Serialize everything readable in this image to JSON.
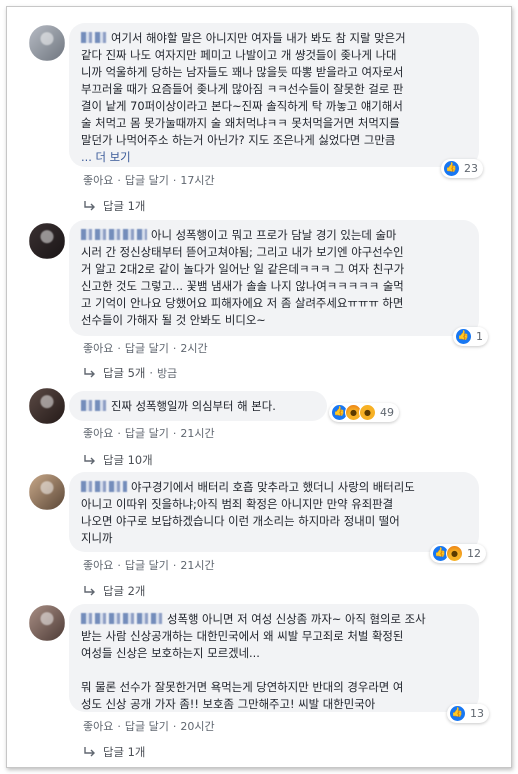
{
  "comments": [
    {
      "text_lines": [
        "여기서 해야할 말은 아니지만 여자들 내가 봐도 참 지랄 맞은거",
        "같다 진짜 나도 여자지만 페미고 나발이고 개 썅것들이 좆나게 나대",
        "니까 억울하게 당하는 남자들도 꽤나 많을듯 따뽕 받을라고 여자로서",
        "부끄러울 때가 요즘들어 좆나게 많아짐 ㅋㅋ선수들이 잘못한 걸로 판",
        "결이 낱게 70퍼이상이라고 본다~진짜 솔직하게 탁 까놓고 얘기해서",
        "술 처먹고 몸 못가눌때까지 술 왜처먹냐ㅋㅋ 못처먹을거면 처먹지를",
        "말던가 나먹어주소 하는거 아닌가? 지도 조은나게 싫었다면 그만큼"
      ],
      "see_more": "... 더 보기",
      "like_label": "좋아요",
      "reply_label": "답글 달기",
      "time": "17시간",
      "reaction_count": "23",
      "replies": "답글 1개"
    },
    {
      "text_lines": [
        "아니 성폭행이고 뭐고 프로가 담날 경기 있는데 술마",
        "시러 간 정신상태부터 뜯어고쳐야됨; 그리고 내가 보기엔 야구선수인",
        "거 알고 2대2로 같이 놀다가 일어난 일 같은데ㅋㅋㅋ 그 여자 친구가",
        "신고한 것도 그렇고... 꽃뱀 냄새가 솔솔 나지 않나여ㅋㅋㅋㅋㅋ 술먹",
        "고 기억이 안나요 당했어요 피해자에요 저 좀 살려주세요ㅠㅠㅠ 하면",
        "선수들이 가해자 될 것 안봐도 비디오~"
      ],
      "like_label": "좋아요",
      "reply_label": "답글 달기",
      "time": "2시간",
      "reaction_count": "1",
      "replies": "답글 5개",
      "replies_extra": "방금"
    },
    {
      "text_lines": [
        "진짜 성폭행일까 의심부터 해 본다."
      ],
      "like_label": "좋아요",
      "reply_label": "답글 달기",
      "time": "21시간",
      "reaction_count": "49",
      "replies": "답글 10개"
    },
    {
      "text_lines": [
        "야구경기에서 배터리 호흡 맞추라고 했더니 사랑의 배터리도",
        "아니고 이따위 짓을하냐;아직 범죄 확정은 아니지만 만약 유죄판결",
        "나오면 야구로 보답하겠습니다 이런 개소리는 하지마라 정내미 떨어",
        "지니까"
      ],
      "like_label": "좋아요",
      "reply_label": "답글 달기",
      "time": "21시간",
      "reaction_count": "12",
      "replies": "답글 2개"
    },
    {
      "text_lines": [
        "성폭행 아니면 저 여성 신상좀 까자~ 아직 혐의로 조사",
        "받는 사람 신상공개하는 대한민국에서 왜 씨발 무고죄로 처벌 확정된",
        "여성들 신상은 보호하는지 모르겠네...",
        "",
        "뭐 물론 선수가 잘못한거면 욕먹는게 당연하지만 반대의 경우라면 여",
        "성도 신상 공개 가자 좀!! 보호좀 그만해주고! 씨발 대한민국아"
      ],
      "like_label": "좋아요",
      "reply_label": "답글 달기",
      "time": "20시간",
      "reaction_count": "13",
      "replies": "답글 1개"
    }
  ],
  "colors": {
    "bubble": "#f2f3f5",
    "text": "#1d2129",
    "meta": "#606770",
    "link": "#385898",
    "like_blue": "#1877f2"
  },
  "icons": [
    "like-icon",
    "angry-icon",
    "haha-icon",
    "reply-arrow-icon"
  ]
}
